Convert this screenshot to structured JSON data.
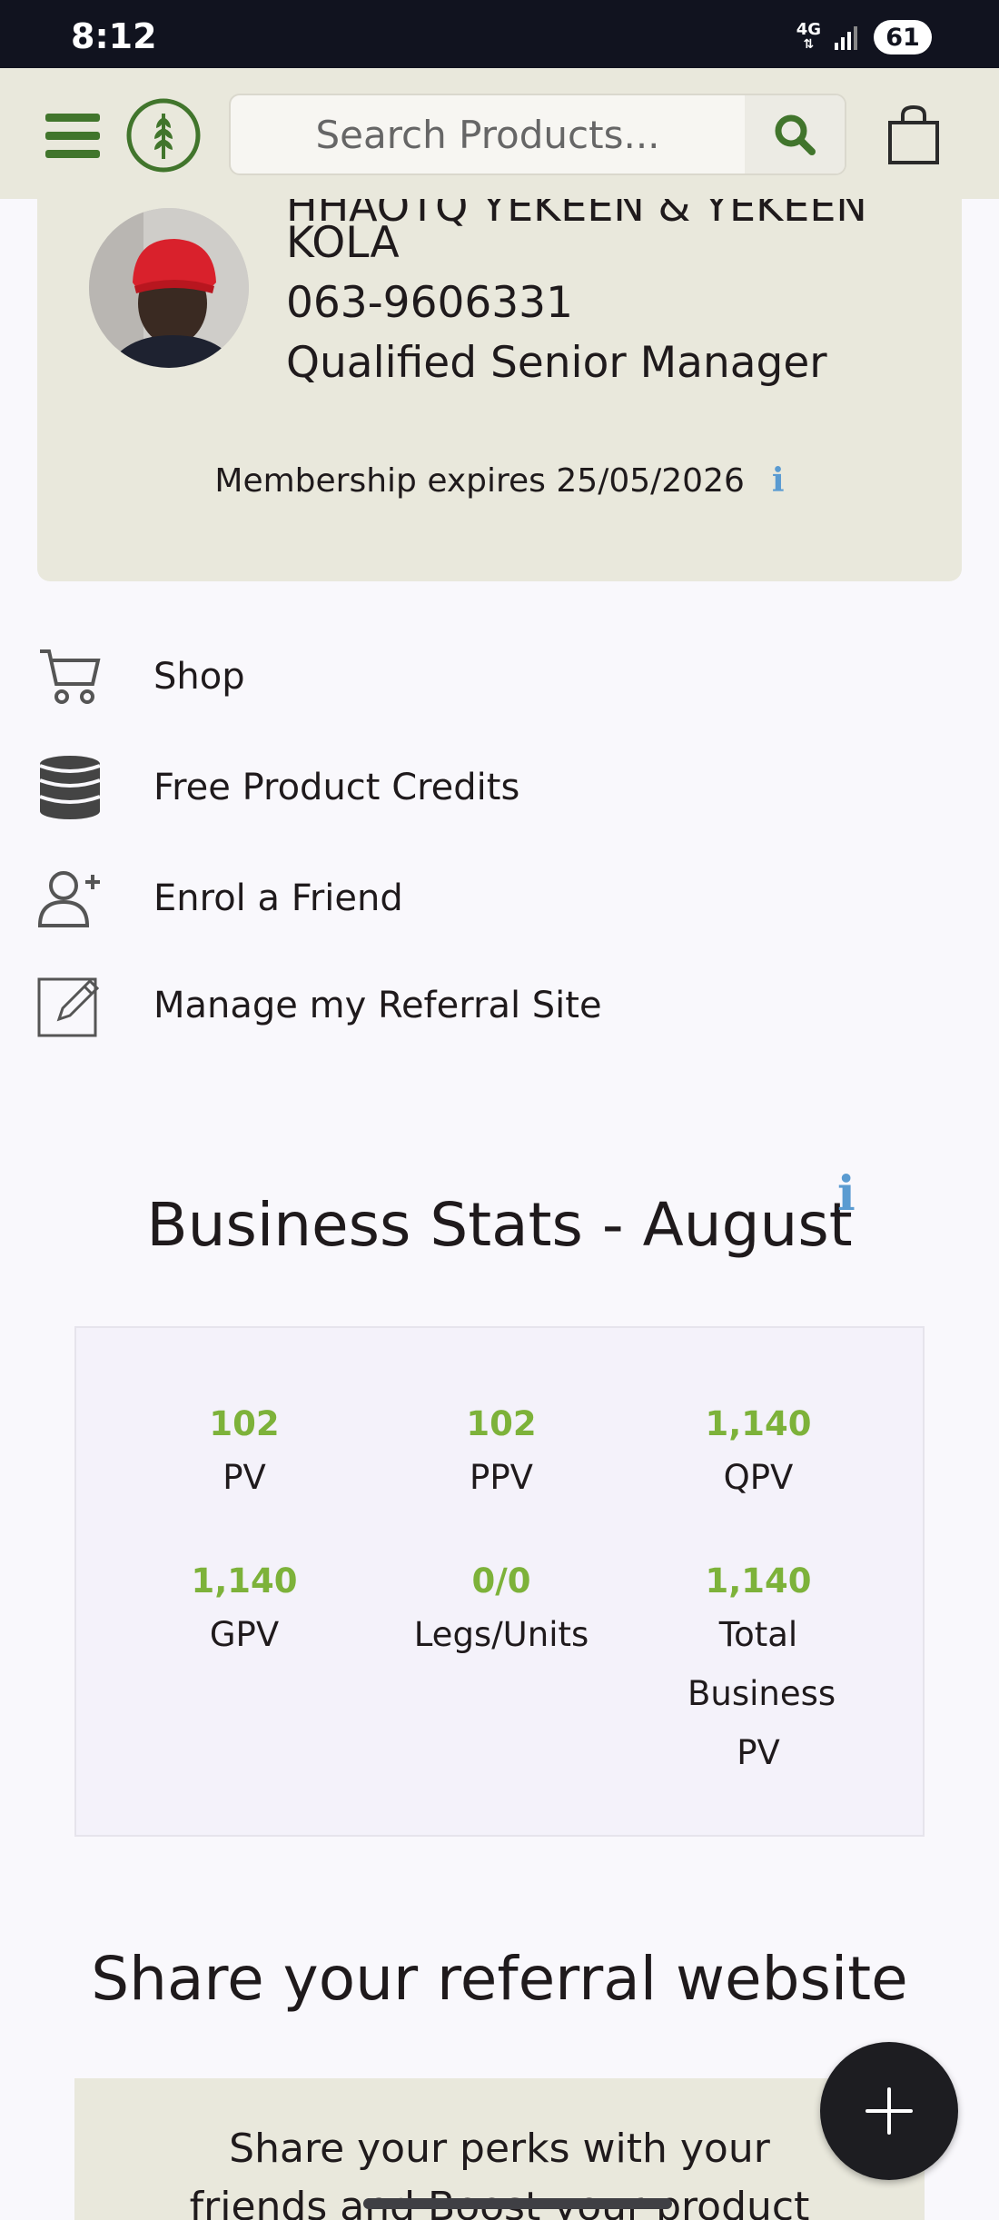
{
  "status_bar": {
    "time": "8:12",
    "network": "4G",
    "battery": "61"
  },
  "header": {
    "search_placeholder": "Search Products..."
  },
  "profile": {
    "name_partial": "HHAOTQ YEKEEN & YEKEEN",
    "name_line2": "KOLA",
    "member_id": "063-9606331",
    "rank": "Qualified Senior Manager",
    "membership": "Membership expires 25/05/2026"
  },
  "menu": {
    "items": [
      {
        "label": "Shop",
        "icon": "shopping-cart-icon"
      },
      {
        "label": "Free Product Credits",
        "icon": "coin-stack-icon"
      },
      {
        "label": "Enrol a Friend",
        "icon": "add-user-icon"
      },
      {
        "label": "Manage my Referral Site",
        "icon": "edit-icon"
      }
    ]
  },
  "stats": {
    "title": "Business Stats - August",
    "items": [
      {
        "value": "102",
        "label": "PV"
      },
      {
        "value": "102",
        "label": "PPV"
      },
      {
        "value": "1,140",
        "label": "QPV"
      },
      {
        "value": "1,140",
        "label": "GPV"
      },
      {
        "value": "0/0",
        "label": "Legs/Units"
      },
      {
        "value": "1,140",
        "label": "Total Business PV"
      }
    ]
  },
  "share": {
    "title": "Share your referral website",
    "text": "Share your perks with your friends and Boost your product sales &"
  },
  "colors": {
    "header_bg": "#e9e8dc",
    "brand_green": "#41752c",
    "stat_green": "#7db23a",
    "info_blue": "#5a9bd1",
    "fab_bg": "#1d1d21"
  }
}
